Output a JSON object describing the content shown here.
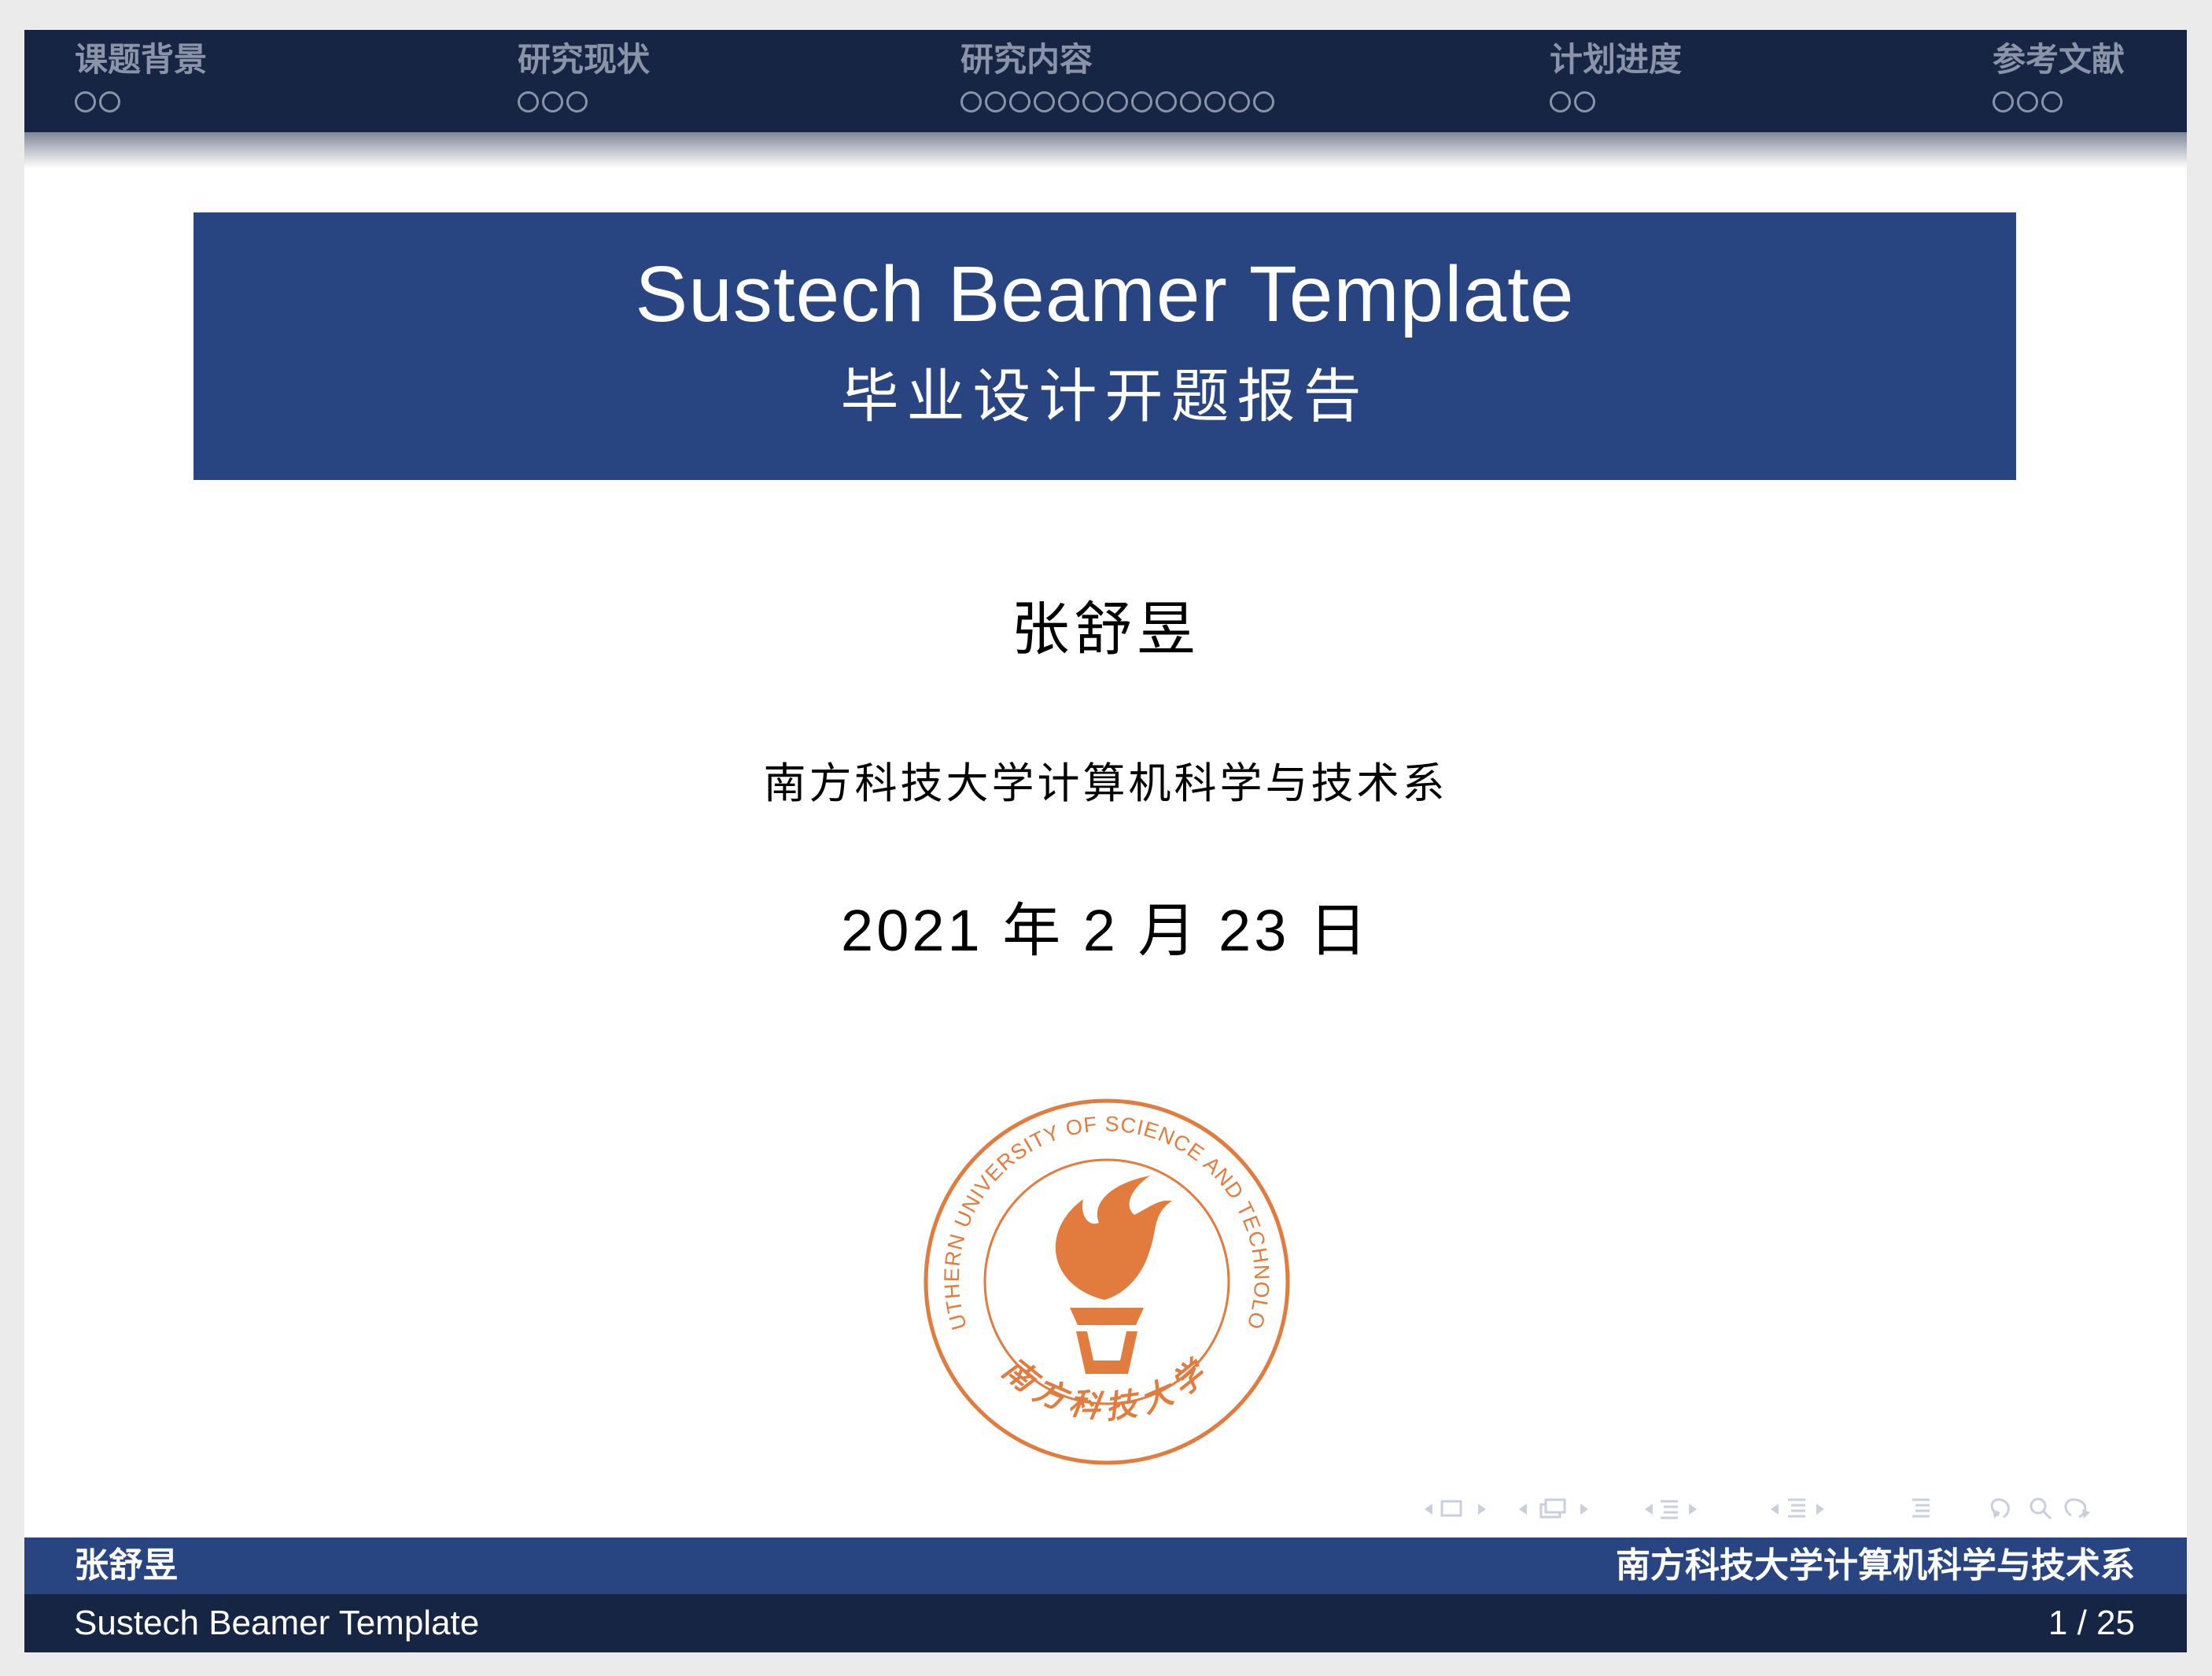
{
  "nav": {
    "sections": [
      {
        "title": "课题背景",
        "dots": 2
      },
      {
        "title": "研究现状",
        "dots": 3
      },
      {
        "title": "研究内容",
        "dots": 13
      },
      {
        "title": "计划进度",
        "dots": 2
      },
      {
        "title": "参考文献",
        "dots": 3
      }
    ]
  },
  "title": {
    "main": "Sustech Beamer Template",
    "sub": "毕业设计开题报告"
  },
  "author": "张舒昱",
  "institute": "南方科技大学计算机科学与技术系",
  "date": "2021 年 2 月 23 日",
  "logo": {
    "ring_text_top": "SOUTHERN UNIVERSITY OF SCIENCE AND TECHNOLOGY",
    "ring_text_bottom": "南方科技大学",
    "color": "#e27b3e"
  },
  "footer": {
    "author": "张舒昱",
    "institute": "南方科技大学计算机科学与技术系",
    "short_title": "Sustech Beamer Template",
    "page": "1 / 25"
  },
  "colors": {
    "nav_bg": "#172544",
    "title_bg": "#294581",
    "nav_text": "#8a93a8",
    "accent": "#e27b3e"
  }
}
